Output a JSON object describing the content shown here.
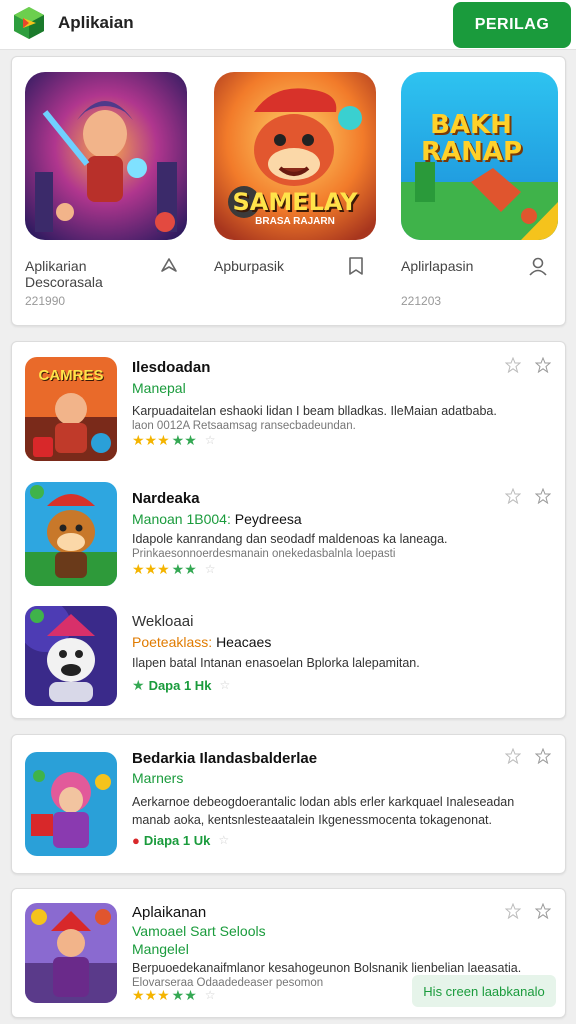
{
  "header": {
    "title": "Aplikaian",
    "install_label": "PERILAG"
  },
  "featured": [
    {
      "label": "Aplikarian Descorasala",
      "meta": "221990",
      "icon": "share-icon"
    },
    {
      "label": "Apburpasik",
      "meta": "",
      "icon": "bookmark-icon",
      "art_title": "SAMELAY",
      "art_sub": "BRASA RAJARN"
    },
    {
      "label": "Aplirlapasin",
      "meta": "221203",
      "icon": "user-icon",
      "art_title": "BAKH RANAP"
    }
  ],
  "list": [
    {
      "title": "Ilesdoadan",
      "subtitle": "Manepal",
      "subtitle_extra": "",
      "desc1": "Karpuadaitelan eshaoki  lidan  I  beam blladkas. IleMaian adatbaba.",
      "desc2": "laon  0012A Retsaamsag ransecbadeundan.",
      "stars": "★★★★★",
      "rating": "",
      "art_title": "CAMRES"
    },
    {
      "title": "Nardeaka",
      "subtitle": "Manoan 1B004:",
      "subtitle_extra": "Peydreesa",
      "desc1": "Idapole kanrandang dan seodadf maldenoas ka laneaga.",
      "desc2": "Prinkaesonnoerdesmanain onekedasbalnla loepasti",
      "stars": "★★★★★",
      "rating": "",
      "art_title": ""
    },
    {
      "title": "Wekloaai",
      "subtitle": "Poeteaklass:",
      "subtitle_extra": "Heacaes",
      "desc1": "Ilapen batal  Intanan enasoelan  Bplorka lalepamitan.",
      "desc2": "",
      "stars": "★",
      "rating": "Dapa 1 Hk",
      "art_title": ""
    }
  ],
  "list2": {
    "title": "Bedarkia Ilandasbalderlae",
    "subtitle": "Marners",
    "desc1": "Aerkarnoe debeogdoerantalic lodan  abls  erler  karkquael  Inaleseadan",
    "desc2": "manab aoka, kentsnlesteaatalein Ikgenessmocenta tokagenonat.",
    "rating": "Diapa 1 Uk",
    "art_title": ""
  },
  "list3": {
    "title": "Aplaikanan",
    "subtitle": "Vamoael Sart Selools",
    "subtitle2": "Mangelel",
    "desc1": "Berpuoedekanaifmlanor kesahogeunon Bolsnanik lienbelian laeasatia.",
    "desc2": "Elovarseraa Odaadedeaser pesomon",
    "stars": "★★★★★",
    "art_title": ""
  },
  "toast": "His creen laabkanalo"
}
